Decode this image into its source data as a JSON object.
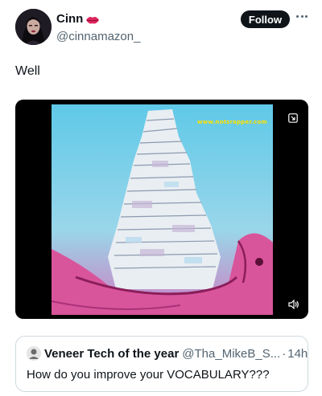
{
  "author": {
    "display_name": "Cinn",
    "handle": "@cinnamazon_"
  },
  "follow_label": "Follow",
  "tweet": {
    "text": "Well"
  },
  "media": {
    "watermark": "www.notsrapper.com"
  },
  "quote": {
    "name": "Veneer Tech of the year",
    "handle": "@Tha_MikeB_S...",
    "separator": "·",
    "time": "14h",
    "text": "How do you improve your VOCABULARY???"
  },
  "colors": {
    "text": "#0f1419",
    "secondary": "#536471",
    "border": "#cfd9de",
    "follow_bg": "#0f1419"
  }
}
